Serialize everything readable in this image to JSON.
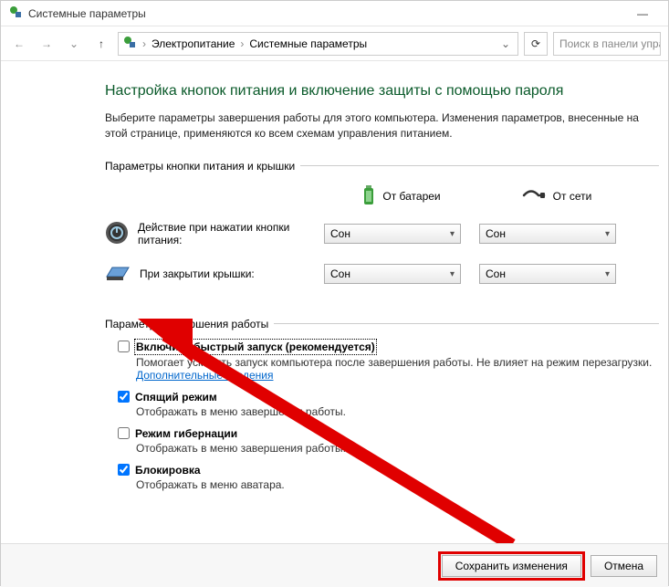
{
  "window": {
    "title": "Системные параметры",
    "minimize_glyph": "—"
  },
  "toolbar": {
    "back_glyph": "←",
    "forward_glyph": "→",
    "dropdown_glyph": "⌄",
    "up_glyph": "↑",
    "crumb1": "Электропитание",
    "crumb2": "Системные параметры",
    "sep": "›",
    "addr_dropdown": "⌄",
    "refresh_glyph": "⟳",
    "search_placeholder": "Поиск в панели упра"
  },
  "main": {
    "heading": "Настройка кнопок питания и включение защиты с помощью пароля",
    "intro": "Выберите параметры завершения работы для этого компьютера. Изменения параметров, внесенные на этой странице, применяются ко всем схемам управления питанием."
  },
  "group1": {
    "legend": "Параметры кнопки питания и крышки",
    "battery_label": "От батареи",
    "plugged_label": "От сети",
    "row1_label": "Действие при нажатии кнопки питания:",
    "row2_label": "При закрытии крышки:",
    "selects": {
      "r1c1": "Сон",
      "r1c2": "Сон",
      "r2c1": "Сон",
      "r2c2": "Сон"
    }
  },
  "group2": {
    "legend": "Параметры завершения работы",
    "opt1": {
      "checked": false,
      "title": "Включить быстрый запуск (рекомендуется)",
      "desc_a": "Помогает ускорить запуск компьютера после завершения работы. Не влияет на режим перезагрузки. ",
      "link": "Дополнительные сведения"
    },
    "opt2": {
      "checked": true,
      "title": "Спящий режим",
      "desc": "Отображать в меню завершения работы."
    },
    "opt3": {
      "checked": false,
      "title": "Режим гибернации",
      "desc": "Отображать в меню завершения работы."
    },
    "opt4": {
      "checked": true,
      "title": "Блокировка",
      "desc": "Отображать в меню аватара."
    }
  },
  "footer": {
    "save": "Сохранить изменения",
    "cancel": "Отмена"
  }
}
